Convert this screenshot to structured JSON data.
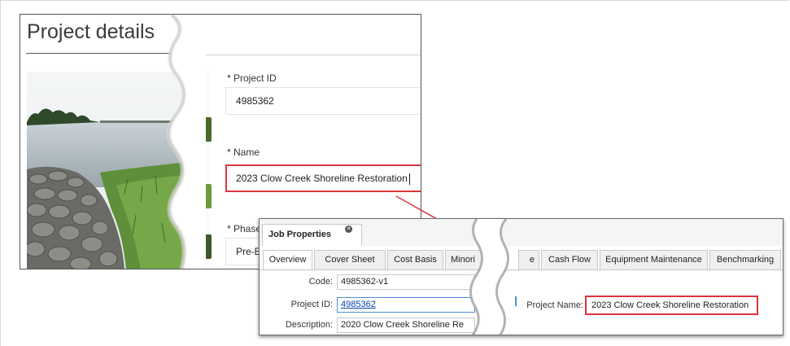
{
  "project_details": {
    "title": "Project details",
    "project_id": {
      "label": "* Project ID",
      "value": "4985362"
    },
    "name": {
      "label": "* Name",
      "value": "2023 Clow Creek Shoreline Restoration"
    },
    "phase": {
      "label": "* Phase",
      "value": "Pre-E"
    }
  },
  "job_properties": {
    "tab_title": "Job Properties",
    "tabs": [
      {
        "label": "Overview",
        "active": true
      },
      {
        "label": "Cover Sheet"
      },
      {
        "label": "Cost Basis"
      },
      {
        "label": "Minori"
      },
      {
        "label": "e"
      },
      {
        "label": "Cash Flow"
      },
      {
        "label": "Equipment Maintenance"
      },
      {
        "label": "Benchmarking"
      }
    ],
    "code": {
      "label": "Code:",
      "value": "4985362-v1"
    },
    "project_id": {
      "label": "Project ID:",
      "value": "4985362"
    },
    "description": {
      "label": "Description:",
      "value": "2020 Clow Creek Shoreline Re"
    },
    "project_name": {
      "label": "Project Name:",
      "value": "2023 Clow Creek Shoreline Restoration"
    }
  },
  "colors": {
    "highlight": "#d9363e",
    "link": "#0645ad"
  }
}
